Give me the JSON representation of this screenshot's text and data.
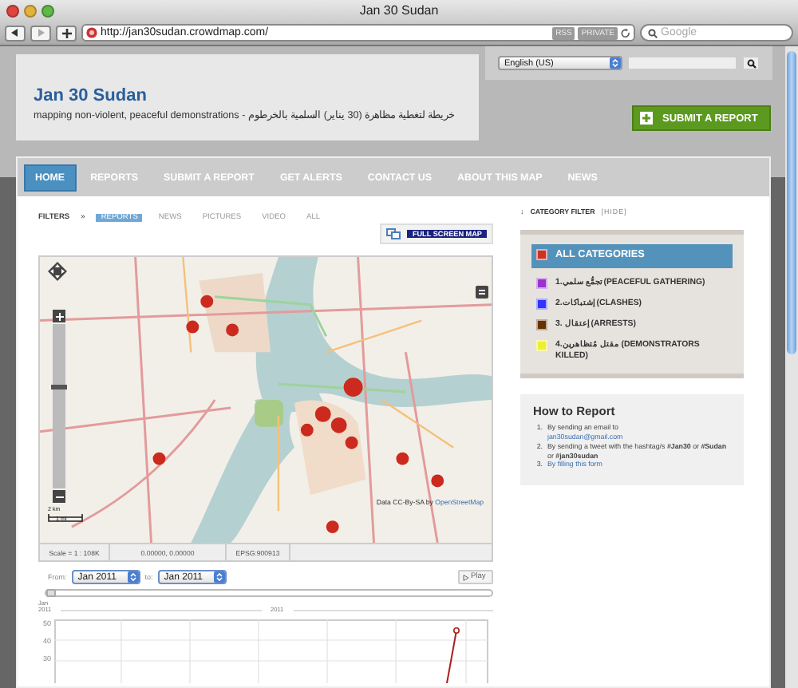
{
  "window": {
    "title": "Jan 30 Sudan"
  },
  "toolbar": {
    "url": "http://jan30sudan.crowdmap.com/",
    "badges": [
      "RSS",
      "PRIVATE"
    ],
    "search_placeholder": "Google"
  },
  "header": {
    "title": "Jan 30 Sudan",
    "tagline": "mapping non-violent, peaceful demonstrations - خريطة لتغطية مظاهرة (30 يناير) السلمية بالخرطوم"
  },
  "language": {
    "value": "English (US)"
  },
  "submit_button": "SUBMIT A REPORT",
  "nav": [
    {
      "label": "HOME",
      "selected": true
    },
    {
      "label": "REPORTS",
      "selected": false
    },
    {
      "label": "SUBMIT A REPORT",
      "selected": false
    },
    {
      "label": "GET ALERTS",
      "selected": false
    },
    {
      "label": "CONTACT US",
      "selected": false
    },
    {
      "label": "ABOUT THIS MAP",
      "selected": false
    },
    {
      "label": "NEWS",
      "selected": false
    }
  ],
  "filters": {
    "label": "FILTERS",
    "arrow": "»",
    "items": [
      {
        "label": "REPORTS",
        "selected": true
      },
      {
        "label": "NEWS",
        "selected": false
      },
      {
        "label": "PICTURES",
        "selected": false
      },
      {
        "label": "VIDEO",
        "selected": false
      },
      {
        "label": "ALL",
        "selected": false
      }
    ]
  },
  "fullscreen_button": "FULL SCREEN MAP",
  "map": {
    "kind": "picture",
    "zoom": {
      "level": 0.63
    },
    "attribution": "Data CC-By-SA by",
    "attribution_link": "OpenStreetMap",
    "scale_top": "2 km",
    "scale_bottom": "1 mi",
    "status": [
      "Scale = 1 : 108K",
      "0.00000, 0.00000",
      "EPSG:900913"
    ]
  },
  "timeline": {
    "from_label": "From:",
    "from": "Jan 2011",
    "to_label": "to:",
    "to": "Jan 2011",
    "play": "Play",
    "level": 0,
    "start_month": "Jan",
    "start_year": "2011",
    "year": "2011",
    "y_ticks": [
      "50",
      "40",
      "30"
    ]
  },
  "category_filter": {
    "arrow": "↓",
    "label": "CATEGORY FILTER",
    "hide": "[HIDE]",
    "items": [
      {
        "label": "ALL CATEGORIES",
        "color": "#cc3322",
        "selected": true
      },
      {
        "label": "1.تجمُّع سلمي (PEACEFUL GATHERING)",
        "color": "#9933cc",
        "selected": false
      },
      {
        "label": "2.إشتباكات (CLASHES)",
        "color": "#3333ff",
        "selected": false
      },
      {
        "label": "3. إعتقال (ARRESTS)",
        "color": "#663300",
        "selected": false
      },
      {
        "label": "4.مقتل مُتظاهرين (DEMONSTRATORS KILLED)",
        "color": "#eeee33",
        "selected": false
      }
    ]
  },
  "how_to_report": {
    "title": "How to Report",
    "items": [
      {
        "number": "1.",
        "text": "By sending an email to",
        "link": "jan30sudan@gmail.com"
      },
      {
        "number": "2.",
        "text": "By sending a tweet with the hashtag/s **#Jan30** or **#Sudan** or **#jan30sudan**"
      },
      {
        "number": "3.",
        "link": "By filling this form"
      }
    ]
  }
}
